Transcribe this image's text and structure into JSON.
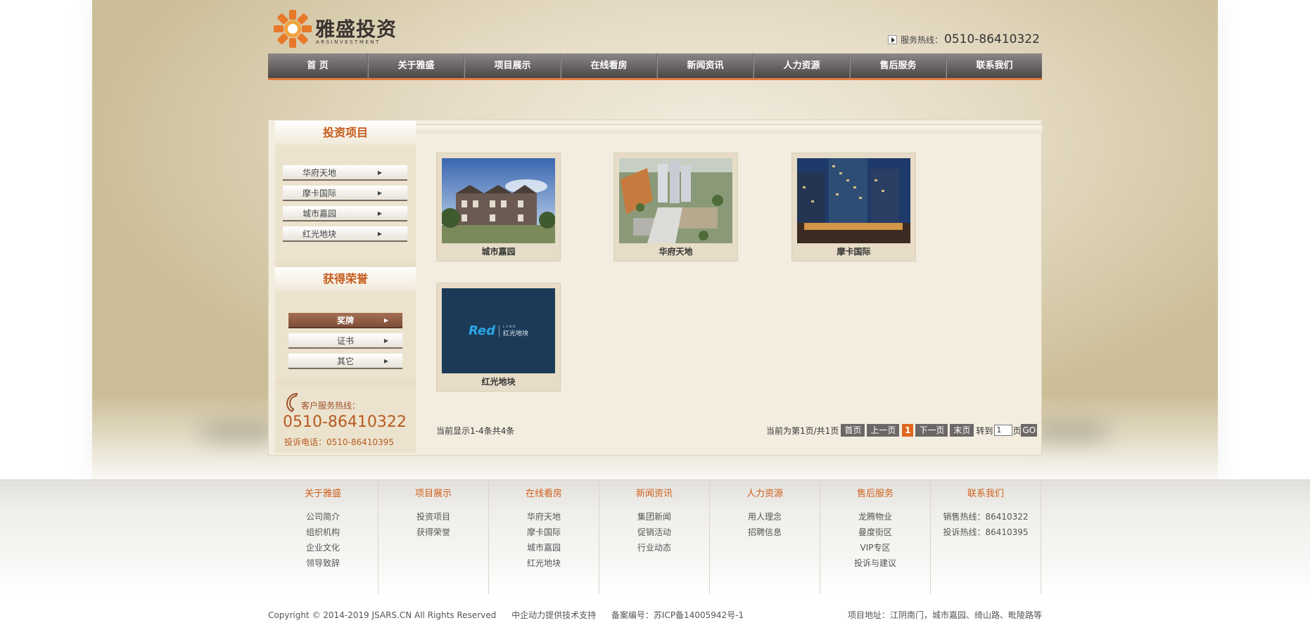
{
  "brand": {
    "logo_cn": "雅盛投资",
    "logo_en": "ARSINVESTMENT",
    "hotline_label": "服务热线：",
    "hotline_number": "0510-86410322",
    "accent": "#e07b3f"
  },
  "nav": [
    "首 页",
    "关于雅盛",
    "项目展示",
    "在线看房",
    "新闻资讯",
    "人力资源",
    "售后服务",
    "联系我们"
  ],
  "sidebar": {
    "projects_title": "投资项目",
    "projects": [
      "华府天地",
      "摩卡国际",
      "城市嘉园",
      "红光地块"
    ],
    "honors_title": "获得荣誉",
    "honors": [
      "奖牌",
      "证书",
      "其它"
    ],
    "active_honor": "奖牌",
    "contact_label": "客户服务热线：",
    "contact_number": "0510-86410322",
    "complaint": "投诉电话：0510-86410395"
  },
  "items": [
    {
      "caption": "城市嘉园",
      "image": "townhouse-photo"
    },
    {
      "caption": "华府天地",
      "image": "aerial-complex-photo"
    },
    {
      "caption": "摩卡国际",
      "image": "night-tower-photo"
    },
    {
      "caption": "红光地块",
      "image": "red-logo-board",
      "logo_text": "Red",
      "logo_cn": "红光地块",
      "logo_sub": "LAND"
    }
  ],
  "listing": {
    "count_text": "当前显示1-4条共4条",
    "page_info": "当前为第1页/共1页",
    "first": "首页",
    "prev": "上一页",
    "current": "1",
    "next": "下一页",
    "last": "末页",
    "goto_label": "转到",
    "goto_value": "1",
    "page_label": "页",
    "go": "GO"
  },
  "footer": {
    "columns": [
      {
        "title": "关于雅盛",
        "links": [
          "公司简介",
          "组织机构",
          "企业文化",
          "领导致辞"
        ]
      },
      {
        "title": "项目展示",
        "links": [
          "投资项目",
          "获得荣誉"
        ]
      },
      {
        "title": "在线看房",
        "links": [
          "华府天地",
          "摩卡国际",
          "城市嘉园",
          "红光地块"
        ]
      },
      {
        "title": "新闻资讯",
        "links": [
          "集团新闻",
          "促销活动",
          "行业动态"
        ]
      },
      {
        "title": "人力资源",
        "links": [
          "用人理念",
          "招聘信息"
        ]
      },
      {
        "title": "售后服务",
        "links": [
          "龙腾物业",
          "曼度街区",
          "VIP专区",
          "投诉与建议"
        ]
      },
      {
        "title": "联系我们",
        "links": [
          "销售热线：86410322",
          "投诉热线：86410395"
        ]
      }
    ],
    "copyright": "Copyright © 2014-2019 JSARS.CN All Rights Reserved",
    "tech_support": "中企动力提供技术支持",
    "icp": "备案编号：苏ICP备14005942号-1",
    "address": "项目地址：江阴南门，城市嘉园、绮山路、毗陵路等"
  }
}
